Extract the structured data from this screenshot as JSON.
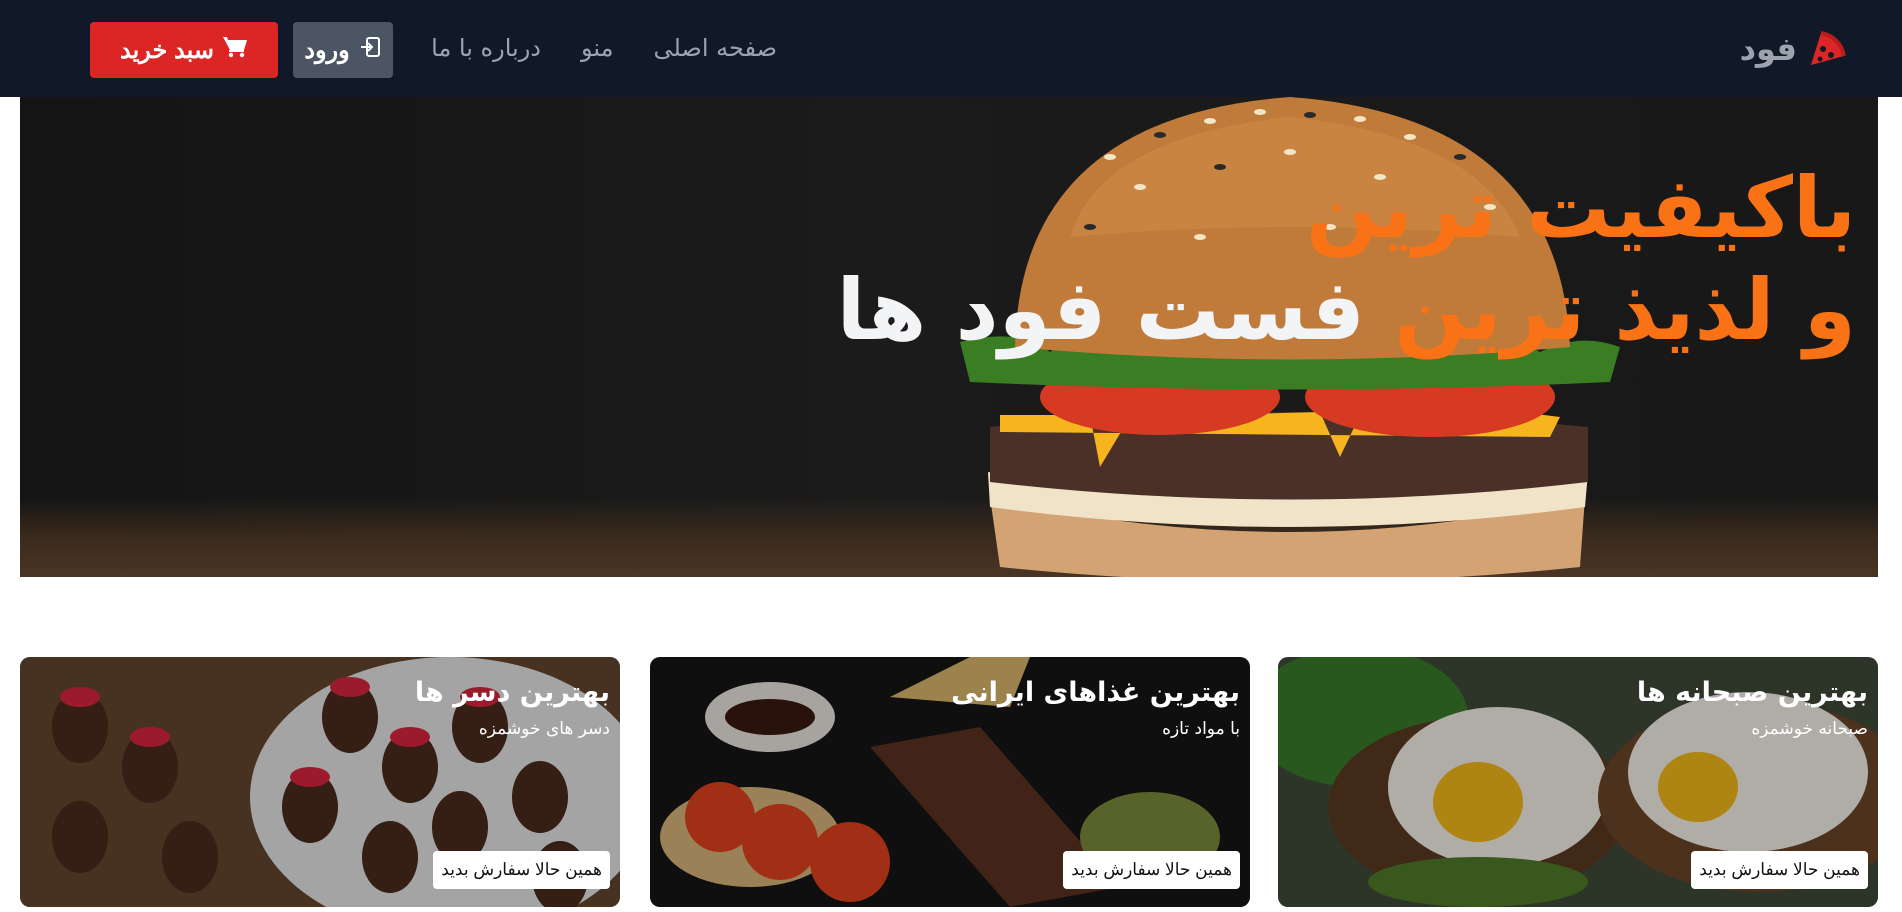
{
  "navbar": {
    "brand_name": "فود",
    "brand_icon": "pizza-slice-icon",
    "links": [
      "صفحه اصلی",
      "منو",
      "درباره با ما"
    ],
    "login_label": "ورود",
    "login_icon": "sign-in-icon",
    "cart_label": "سبد خرید",
    "cart_icon": "shopping-cart-icon"
  },
  "hero": {
    "line1_orange": "باکیفیت ترین",
    "line2_orange": "و لذیذ ترین",
    "line2_white": "فست فود ها"
  },
  "cards": [
    {
      "title": "بهترین صبحانه ها",
      "subtitle": "صبحانه خوشمزه",
      "button": "همین حالا سفارش بدید"
    },
    {
      "title": "بهترین غذاهای ایرانی",
      "subtitle": "با مواد تازه",
      "button": "همین حالا سفارش بدید"
    },
    {
      "title": "بهترین دسر ها",
      "subtitle": "دسر های خوشمزه",
      "button": "همین حالا سفارش بدید"
    }
  ],
  "colors": {
    "navbar_bg": "#111827",
    "accent_orange": "#f97316",
    "cart_red": "#dc2626",
    "login_gray": "#4b5563"
  }
}
